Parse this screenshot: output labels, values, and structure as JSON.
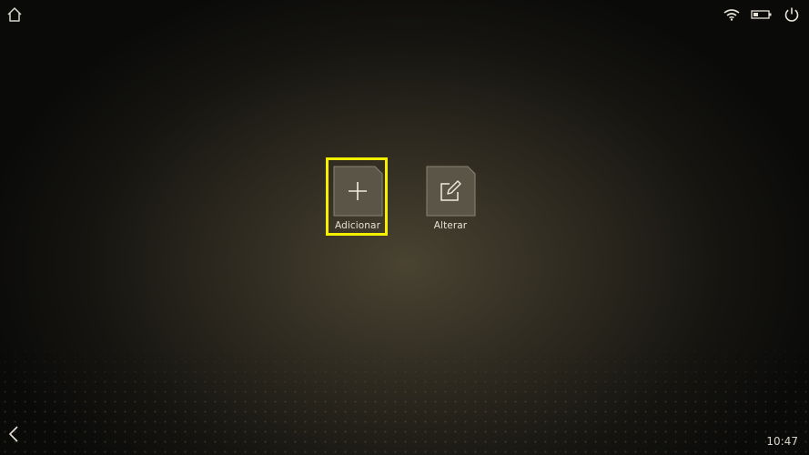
{
  "status_bar": {
    "icons": [
      "home-icon",
      "wifi-icon",
      "battery-icon",
      "power-icon"
    ]
  },
  "main": {
    "tiles": [
      {
        "label": "Adicionar",
        "icon": "plus-icon"
      },
      {
        "label": "Alterar",
        "icon": "edit-icon"
      }
    ],
    "highlight_color": "#f4f000"
  },
  "bottom_bar": {
    "back_icon": "chevron-left-icon",
    "time": "10:47"
  },
  "colors": {
    "tile_fill": "#5a5547",
    "tile_border": "#8a8472",
    "text": "#e6e2d6"
  }
}
